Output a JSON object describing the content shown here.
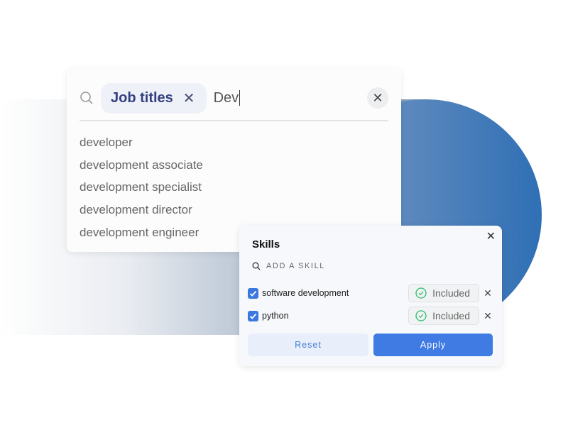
{
  "job_search": {
    "chip_label": "Job titles",
    "query": "Dev",
    "suggestions": [
      "developer",
      "development associate",
      "development specialist",
      "development director",
      "development engineer"
    ]
  },
  "skills": {
    "title": "Skills",
    "add_placeholder": "ADD A SKILL",
    "items": [
      {
        "label": "software development",
        "checked": true,
        "status": "Included"
      },
      {
        "label": "python",
        "checked": true,
        "status": "Included"
      }
    ],
    "reset_label": "Reset",
    "apply_label": "Apply"
  },
  "colors": {
    "accent": "#3f7be3",
    "chip_text": "#343f7f",
    "included_check": "#2ebd6b"
  }
}
